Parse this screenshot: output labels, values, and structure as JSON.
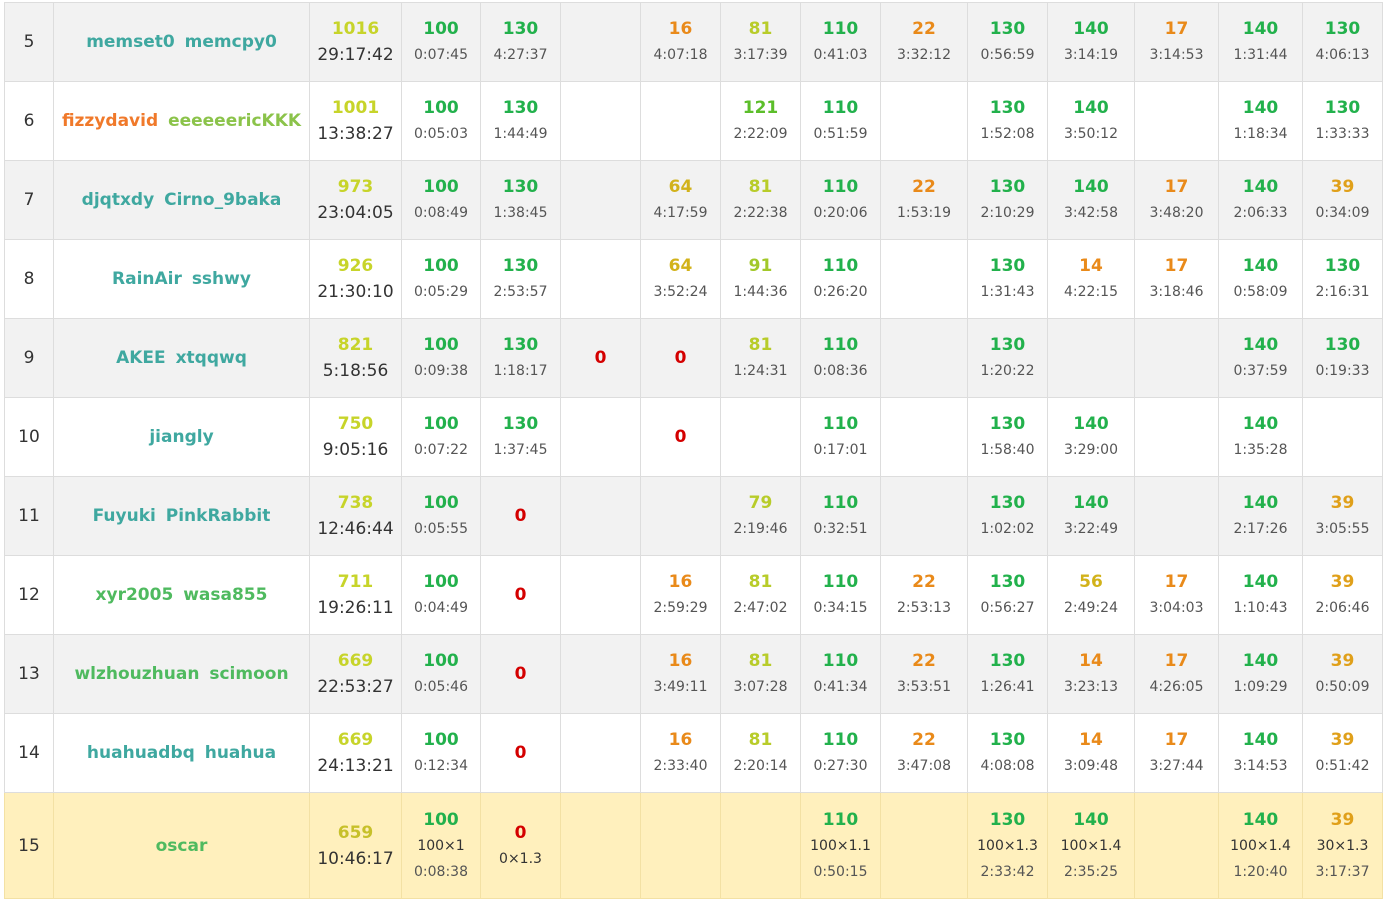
{
  "colors": {
    "teal": "#3fa8a0",
    "green": "#4fba5f",
    "orange": "#f0792a",
    "lime": "#8bc34a",
    "full": "#22b14c",
    "zero": "#e00000",
    "highlight": "#fff0bd"
  },
  "rows": [
    {
      "rank": "5",
      "parity": "odd",
      "users": [
        {
          "name": "memset0",
          "color": "#3fa8a0"
        },
        {
          "name": "memcpy0",
          "color": "#3fa8a0"
        }
      ],
      "total": {
        "score": "1016",
        "time": "29:17:42",
        "color": "#c7d42a"
      },
      "problems": [
        {
          "score": "100",
          "time": "0:07:45",
          "color": "#22b14c"
        },
        {
          "score": "130",
          "time": "4:27:37",
          "color": "#22b14c"
        },
        null,
        {
          "score": "16",
          "time": "4:07:18",
          "color": "#e98a1a"
        },
        {
          "score": "81",
          "time": "3:17:39",
          "color": "#b8cc2a"
        },
        {
          "score": "110",
          "time": "0:41:03",
          "color": "#22b14c"
        },
        {
          "score": "22",
          "time": "3:32:12",
          "color": "#e98a1a"
        },
        {
          "score": "130",
          "time": "0:56:59",
          "color": "#22b14c"
        },
        {
          "score": "140",
          "time": "3:14:19",
          "color": "#22b14c"
        },
        {
          "score": "17",
          "time": "3:14:53",
          "color": "#e98a1a"
        },
        {
          "score": "140",
          "time": "1:31:44",
          "color": "#22b14c"
        },
        {
          "score": "130",
          "time": "4:06:13",
          "color": "#22b14c"
        }
      ]
    },
    {
      "rank": "6",
      "parity": "even",
      "users": [
        {
          "name": "fizzydavid",
          "color": "#f0792a"
        },
        {
          "name": "eeeeeericKKK",
          "color": "#8bc34a"
        }
      ],
      "total": {
        "score": "1001",
        "time": "13:38:27",
        "color": "#c7d42a"
      },
      "problems": [
        {
          "score": "100",
          "time": "0:05:03",
          "color": "#22b14c"
        },
        {
          "score": "130",
          "time": "1:44:49",
          "color": "#22b14c"
        },
        null,
        null,
        {
          "score": "121",
          "time": "2:22:09",
          "color": "#5cbe2a"
        },
        {
          "score": "110",
          "time": "0:51:59",
          "color": "#22b14c"
        },
        null,
        {
          "score": "130",
          "time": "1:52:08",
          "color": "#22b14c"
        },
        {
          "score": "140",
          "time": "3:50:12",
          "color": "#22b14c"
        },
        null,
        {
          "score": "140",
          "time": "1:18:34",
          "color": "#22b14c"
        },
        {
          "score": "130",
          "time": "1:33:33",
          "color": "#22b14c"
        }
      ]
    },
    {
      "rank": "7",
      "parity": "odd",
      "users": [
        {
          "name": "djqtxdy",
          "color": "#3fa8a0"
        },
        {
          "name": "Cirno_9baka",
          "color": "#3fa8a0"
        }
      ],
      "total": {
        "score": "973",
        "time": "23:04:05",
        "color": "#c7d42a"
      },
      "problems": [
        {
          "score": "100",
          "time": "0:08:49",
          "color": "#22b14c"
        },
        {
          "score": "130",
          "time": "1:38:45",
          "color": "#22b14c"
        },
        null,
        {
          "score": "64",
          "time": "4:17:59",
          "color": "#d2b21a"
        },
        {
          "score": "81",
          "time": "2:22:38",
          "color": "#b8cc2a"
        },
        {
          "score": "110",
          "time": "0:20:06",
          "color": "#22b14c"
        },
        {
          "score": "22",
          "time": "1:53:19",
          "color": "#e98a1a"
        },
        {
          "score": "130",
          "time": "2:10:29",
          "color": "#22b14c"
        },
        {
          "score": "140",
          "time": "3:42:58",
          "color": "#22b14c"
        },
        {
          "score": "17",
          "time": "3:48:20",
          "color": "#e98a1a"
        },
        {
          "score": "140",
          "time": "2:06:33",
          "color": "#22b14c"
        },
        {
          "score": "39",
          "time": "0:34:09",
          "color": "#e0a01a"
        }
      ]
    },
    {
      "rank": "8",
      "parity": "even",
      "users": [
        {
          "name": "RainAir",
          "color": "#3fa8a0"
        },
        {
          "name": "sshwy",
          "color": "#3fa8a0"
        }
      ],
      "total": {
        "score": "926",
        "time": "21:30:10",
        "color": "#c7d42a"
      },
      "problems": [
        {
          "score": "100",
          "time": "0:05:29",
          "color": "#22b14c"
        },
        {
          "score": "130",
          "time": "2:53:57",
          "color": "#22b14c"
        },
        null,
        {
          "score": "64",
          "time": "3:52:24",
          "color": "#d2b21a"
        },
        {
          "score": "91",
          "time": "1:44:36",
          "color": "#a2c82a"
        },
        {
          "score": "110",
          "time": "0:26:20",
          "color": "#22b14c"
        },
        null,
        {
          "score": "130",
          "time": "1:31:43",
          "color": "#22b14c"
        },
        {
          "score": "14",
          "time": "4:22:15",
          "color": "#e98a1a"
        },
        {
          "score": "17",
          "time": "3:18:46",
          "color": "#e98a1a"
        },
        {
          "score": "140",
          "time": "0:58:09",
          "color": "#22b14c"
        },
        {
          "score": "130",
          "time": "2:16:31",
          "color": "#22b14c"
        }
      ]
    },
    {
      "rank": "9",
      "parity": "odd",
      "users": [
        {
          "name": "AKEE",
          "color": "#3fa8a0"
        },
        {
          "name": "xtqqwq",
          "color": "#3fa8a0"
        }
      ],
      "total": {
        "score": "821",
        "time": "5:18:56",
        "color": "#c7d42a"
      },
      "problems": [
        {
          "score": "100",
          "time": "0:09:38",
          "color": "#22b14c"
        },
        {
          "score": "130",
          "time": "1:18:17",
          "color": "#22b14c"
        },
        {
          "score": "0",
          "time": "",
          "color": "#d40000"
        },
        {
          "score": "0",
          "time": "",
          "color": "#d40000"
        },
        {
          "score": "81",
          "time": "1:24:31",
          "color": "#b8cc2a"
        },
        {
          "score": "110",
          "time": "0:08:36",
          "color": "#22b14c"
        },
        null,
        {
          "score": "130",
          "time": "1:20:22",
          "color": "#22b14c"
        },
        null,
        null,
        {
          "score": "140",
          "time": "0:37:59",
          "color": "#22b14c"
        },
        {
          "score": "130",
          "time": "0:19:33",
          "color": "#22b14c"
        }
      ]
    },
    {
      "rank": "10",
      "parity": "even",
      "users": [
        {
          "name": "jiangly",
          "color": "#3fa8a0"
        }
      ],
      "total": {
        "score": "750",
        "time": "9:05:16",
        "color": "#c7d42a"
      },
      "problems": [
        {
          "score": "100",
          "time": "0:07:22",
          "color": "#22b14c"
        },
        {
          "score": "130",
          "time": "1:37:45",
          "color": "#22b14c"
        },
        null,
        {
          "score": "0",
          "time": "",
          "color": "#d40000"
        },
        null,
        {
          "score": "110",
          "time": "0:17:01",
          "color": "#22b14c"
        },
        null,
        {
          "score": "130",
          "time": "1:58:40",
          "color": "#22b14c"
        },
        {
          "score": "140",
          "time": "3:29:00",
          "color": "#22b14c"
        },
        null,
        {
          "score": "140",
          "time": "1:35:28",
          "color": "#22b14c"
        },
        null
      ]
    },
    {
      "rank": "11",
      "parity": "odd",
      "users": [
        {
          "name": "Fuyuki",
          "color": "#3fa8a0"
        },
        {
          "name": "PinkRabbit",
          "color": "#3fa8a0"
        }
      ],
      "total": {
        "score": "738",
        "time": "12:46:44",
        "color": "#c7d42a"
      },
      "problems": [
        {
          "score": "100",
          "time": "0:05:55",
          "color": "#22b14c"
        },
        {
          "score": "0",
          "time": "",
          "color": "#d40000"
        },
        null,
        null,
        {
          "score": "79",
          "time": "2:19:46",
          "color": "#b8cc2a"
        },
        {
          "score": "110",
          "time": "0:32:51",
          "color": "#22b14c"
        },
        null,
        {
          "score": "130",
          "time": "1:02:02",
          "color": "#22b14c"
        },
        {
          "score": "140",
          "time": "3:22:49",
          "color": "#22b14c"
        },
        null,
        {
          "score": "140",
          "time": "2:17:26",
          "color": "#22b14c"
        },
        {
          "score": "39",
          "time": "3:05:55",
          "color": "#e0a01a"
        }
      ]
    },
    {
      "rank": "12",
      "parity": "even",
      "users": [
        {
          "name": "xyr2005",
          "color": "#4fba5f"
        },
        {
          "name": "wasa855",
          "color": "#4fba5f"
        }
      ],
      "total": {
        "score": "711",
        "time": "19:26:11",
        "color": "#c7d42a"
      },
      "problems": [
        {
          "score": "100",
          "time": "0:04:49",
          "color": "#22b14c"
        },
        {
          "score": "0",
          "time": "",
          "color": "#d40000"
        },
        null,
        {
          "score": "16",
          "time": "2:59:29",
          "color": "#e98a1a"
        },
        {
          "score": "81",
          "time": "2:47:02",
          "color": "#b8cc2a"
        },
        {
          "score": "110",
          "time": "0:34:15",
          "color": "#22b14c"
        },
        {
          "score": "22",
          "time": "2:53:13",
          "color": "#e98a1a"
        },
        {
          "score": "130",
          "time": "0:56:27",
          "color": "#22b14c"
        },
        {
          "score": "56",
          "time": "2:49:24",
          "color": "#d2b21a"
        },
        {
          "score": "17",
          "time": "3:04:03",
          "color": "#e98a1a"
        },
        {
          "score": "140",
          "time": "1:10:43",
          "color": "#22b14c"
        },
        {
          "score": "39",
          "time": "2:06:46",
          "color": "#e0a01a"
        }
      ]
    },
    {
      "rank": "13",
      "parity": "odd",
      "users": [
        {
          "name": "wlzhouzhuan",
          "color": "#4fba5f"
        },
        {
          "name": "scimoon",
          "color": "#4fba5f"
        }
      ],
      "total": {
        "score": "669",
        "time": "22:53:27",
        "color": "#c7d42a"
      },
      "problems": [
        {
          "score": "100",
          "time": "0:05:46",
          "color": "#22b14c"
        },
        {
          "score": "0",
          "time": "",
          "color": "#d40000"
        },
        null,
        {
          "score": "16",
          "time": "3:49:11",
          "color": "#e98a1a"
        },
        {
          "score": "81",
          "time": "3:07:28",
          "color": "#b8cc2a"
        },
        {
          "score": "110",
          "time": "0:41:34",
          "color": "#22b14c"
        },
        {
          "score": "22",
          "time": "3:53:51",
          "color": "#e98a1a"
        },
        {
          "score": "130",
          "time": "1:26:41",
          "color": "#22b14c"
        },
        {
          "score": "14",
          "time": "3:23:13",
          "color": "#e98a1a"
        },
        {
          "score": "17",
          "time": "4:26:05",
          "color": "#e98a1a"
        },
        {
          "score": "140",
          "time": "1:09:29",
          "color": "#22b14c"
        },
        {
          "score": "39",
          "time": "0:50:09",
          "color": "#e0a01a"
        }
      ]
    },
    {
      "rank": "14",
      "parity": "even",
      "users": [
        {
          "name": "huahuadbq",
          "color": "#3fa8a0"
        },
        {
          "name": "huahua",
          "color": "#3fa8a0"
        }
      ],
      "total": {
        "score": "669",
        "time": "24:13:21",
        "color": "#c7d42a"
      },
      "problems": [
        {
          "score": "100",
          "time": "0:12:34",
          "color": "#22b14c"
        },
        {
          "score": "0",
          "time": "",
          "color": "#d40000"
        },
        null,
        {
          "score": "16",
          "time": "2:33:40",
          "color": "#e98a1a"
        },
        {
          "score": "81",
          "time": "2:20:14",
          "color": "#b8cc2a"
        },
        {
          "score": "110",
          "time": "0:27:30",
          "color": "#22b14c"
        },
        {
          "score": "22",
          "time": "3:47:08",
          "color": "#e98a1a"
        },
        {
          "score": "130",
          "time": "4:08:08",
          "color": "#22b14c"
        },
        {
          "score": "14",
          "time": "3:09:48",
          "color": "#e98a1a"
        },
        {
          "score": "17",
          "time": "3:27:44",
          "color": "#e98a1a"
        },
        {
          "score": "140",
          "time": "3:14:53",
          "color": "#22b14c"
        },
        {
          "score": "39",
          "time": "0:51:42",
          "color": "#e0a01a"
        }
      ]
    },
    {
      "rank": "15",
      "parity": "hl",
      "users": [
        {
          "name": "oscar",
          "color": "#4fba5f"
        }
      ],
      "total": {
        "score": "659",
        "time": "10:46:17",
        "color": "#c7c02a"
      },
      "problems": [
        {
          "score": "100",
          "mult": "100×1",
          "time": "0:08:38",
          "color": "#22b14c"
        },
        {
          "score": "0",
          "mult": "0×1.3",
          "time": "",
          "color": "#d40000"
        },
        null,
        null,
        null,
        {
          "score": "110",
          "mult": "100×1.1",
          "time": "0:50:15",
          "color": "#22b14c"
        },
        null,
        {
          "score": "130",
          "mult": "100×1.3",
          "time": "2:33:42",
          "color": "#22b14c"
        },
        {
          "score": "140",
          "mult": "100×1.4",
          "time": "2:35:25",
          "color": "#22b14c"
        },
        null,
        {
          "score": "140",
          "mult": "100×1.4",
          "time": "1:20:40",
          "color": "#22b14c"
        },
        {
          "score": "39",
          "mult": "30×1.3",
          "time": "3:17:37",
          "color": "#e0a01a"
        }
      ]
    }
  ]
}
